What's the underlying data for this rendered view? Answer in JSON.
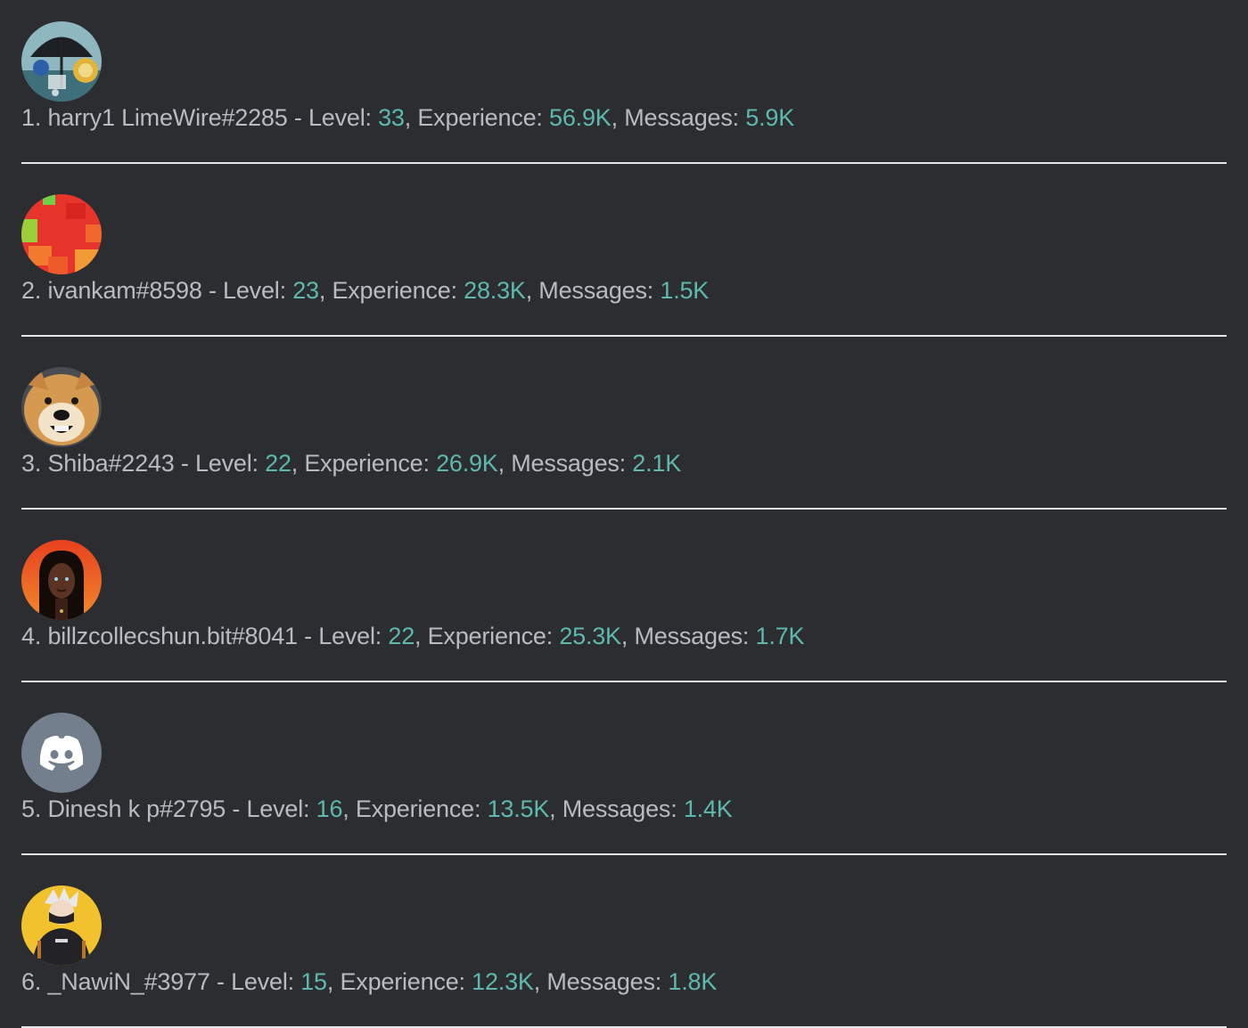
{
  "colors": {
    "background": "#2b2d31",
    "text": "#b9bbc1",
    "highlight": "#5fb8ad",
    "divider": "#e4e5e8"
  },
  "entries": [
    {
      "rank": "1.",
      "name": "harry1 LimeWire#2285",
      "level_label": " - Level: ",
      "level": "33",
      "exp_label": ", Experience: ",
      "experience": "56.9K",
      "msg_label": ", Messages: ",
      "messages": "5.9K",
      "avatar": "umbrella-art-avatar"
    },
    {
      "rank": "2.",
      "name": "ivankam#8598",
      "level_label": " - Level: ",
      "level": "23",
      "exp_label": ", Experience: ",
      "experience": "28.3K",
      "msg_label": ", Messages: ",
      "messages": "1.5K",
      "avatar": "red-pixel-avatar"
    },
    {
      "rank": "3.",
      "name": "Shiba#2243",
      "level_label": " - Level: ",
      "level": "22",
      "exp_label": ", Experience: ",
      "experience": "26.9K",
      "msg_label": ", Messages: ",
      "messages": "2.1K",
      "avatar": "shiba-dog-avatar"
    },
    {
      "rank": "4.",
      "name": "billzcollecshun.bit#8041",
      "level_label": " - Level: ",
      "level": "22",
      "exp_label": ", Experience: ",
      "experience": "25.3K",
      "msg_label": ", Messages: ",
      "messages": "1.7K",
      "avatar": "portrait-avatar"
    },
    {
      "rank": "5.",
      "name": "Dinesh k p#2795",
      "level_label": " - Level: ",
      "level": "16",
      "exp_label": ", Experience: ",
      "experience": "13.5K",
      "msg_label": ", Messages: ",
      "messages": "1.4K",
      "avatar": "discord-default-avatar"
    },
    {
      "rank": "6.",
      "name": "_NawiN_#3977",
      "level_label": " - Level: ",
      "level": "15",
      "exp_label": ", Experience: ",
      "experience": "12.3K",
      "msg_label": ", Messages: ",
      "messages": "1.8K",
      "avatar": "anime-character-avatar"
    }
  ]
}
